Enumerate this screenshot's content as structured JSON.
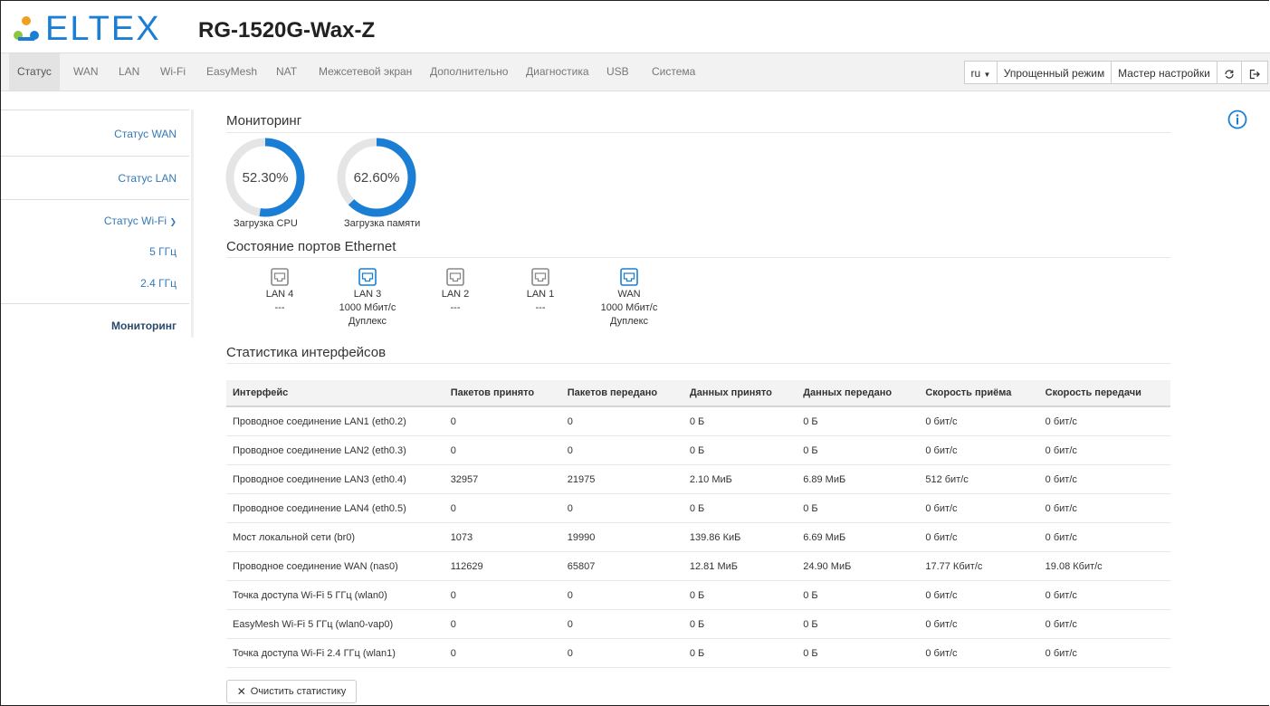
{
  "brand": {
    "logo_text": "ELTEX",
    "model": "RG-1520G-Wax-Z",
    "color": "#1a7fd4"
  },
  "nav": {
    "items": [
      "Статус",
      "WAN",
      "LAN",
      "Wi-Fi",
      "EasyMesh",
      "NAT",
      "Межсетевой экран",
      "Дополнительно",
      "Диагностика",
      "USB",
      "Система"
    ],
    "active": "Статус",
    "lang": "ru",
    "simple_mode": "Упрощенный режим",
    "wizard": "Мастер настройки",
    "refresh_icon": "refresh-icon",
    "logout_icon": "logout-icon"
  },
  "sidebar": {
    "items": [
      "Статус WAN",
      "Статус LAN",
      "Статус Wi-Fi",
      "5 ГГц",
      "2.4 ГГц",
      "Мониторинг"
    ],
    "active": "Мониторинг"
  },
  "monitoring": {
    "title": "Мониторинг",
    "cpu": {
      "value_text": "52.30%",
      "value": 52.3,
      "label": "Загрузка CPU"
    },
    "memory": {
      "value_text": "62.60%",
      "value": 62.6,
      "label": "Загрузка памяти"
    },
    "accent": "#1a7fd4"
  },
  "ports": {
    "title": "Состояние портов Ethernet",
    "list": [
      {
        "name": "LAN 4",
        "line1": "---",
        "line2": "",
        "active": false
      },
      {
        "name": "LAN 3",
        "line1": "1000 Мбит/с",
        "line2": "Дуплекс",
        "active": true
      },
      {
        "name": "LAN 2",
        "line1": "---",
        "line2": "",
        "active": false
      },
      {
        "name": "LAN 1",
        "line1": "---",
        "line2": "",
        "active": false
      },
      {
        "name": "WAN",
        "line1": "1000 Мбит/с",
        "line2": "Дуплекс",
        "active": true
      }
    ]
  },
  "stats": {
    "title": "Статистика интерфейсов",
    "headers": [
      "Интерфейс",
      "Пакетов принято",
      "Пакетов передано",
      "Данных принято",
      "Данных передано",
      "Скорость приёма",
      "Скорость передачи"
    ],
    "rows": [
      [
        "Проводное соединение LAN1 (eth0.2)",
        "0",
        "0",
        "0 Б",
        "0 Б",
        "0 бит/с",
        "0 бит/с"
      ],
      [
        "Проводное соединение LAN2 (eth0.3)",
        "0",
        "0",
        "0 Б",
        "0 Б",
        "0 бит/с",
        "0 бит/с"
      ],
      [
        "Проводное соединение LAN3 (eth0.4)",
        "32957",
        "21975",
        "2.10 МиБ",
        "6.89 МиБ",
        "512 бит/с",
        "0 бит/с"
      ],
      [
        "Проводное соединение LAN4 (eth0.5)",
        "0",
        "0",
        "0 Б",
        "0 Б",
        "0 бит/с",
        "0 бит/с"
      ],
      [
        "Мост локальной сети (br0)",
        "1073",
        "19990",
        "139.86 КиБ",
        "6.69 МиБ",
        "0 бит/с",
        "0 бит/с"
      ],
      [
        "Проводное соединение WAN (nas0)",
        "112629",
        "65807",
        "12.81 МиБ",
        "24.90 МиБ",
        "17.77 Кбит/с",
        "19.08 Кбит/с"
      ],
      [
        "Точка доступа Wi-Fi 5 ГГц (wlan0)",
        "0",
        "0",
        "0 Б",
        "0 Б",
        "0 бит/с",
        "0 бит/с"
      ],
      [
        "EasyMesh Wi-Fi 5 ГГц (wlan0-vap0)",
        "0",
        "0",
        "0 Б",
        "0 Б",
        "0 бит/с",
        "0 бит/с"
      ],
      [
        "Точка доступа Wi-Fi 2.4 ГГц (wlan1)",
        "0",
        "0",
        "0 Б",
        "0 Б",
        "0 бит/с",
        "0 бит/с"
      ]
    ],
    "clear_button": "Очистить статистику"
  }
}
